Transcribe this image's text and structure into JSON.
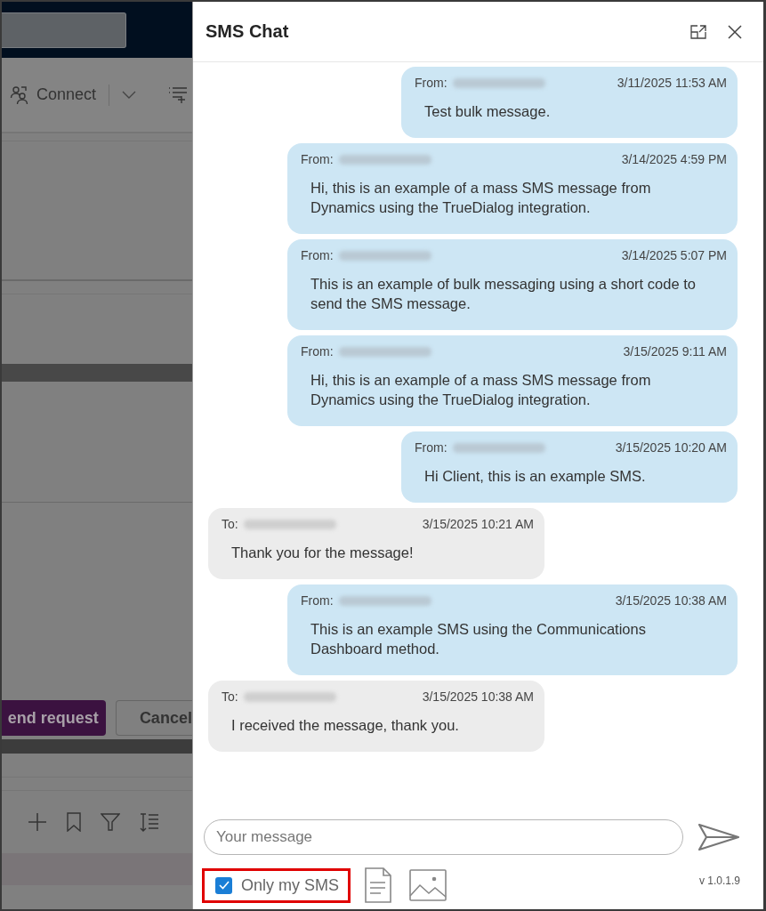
{
  "background": {
    "connect_label": "Connect",
    "primary_button": "end request",
    "secondary_button": "Cancel"
  },
  "panel": {
    "title": "SMS Chat"
  },
  "messages": [
    {
      "kind": "outgoing",
      "label": "From:",
      "timestamp": "3/11/2025 11:53 AM",
      "text": "Test bulk message."
    },
    {
      "kind": "outgoing",
      "label": "From:",
      "timestamp": "3/14/2025 4:59 PM",
      "text": "Hi, this is an example of a mass SMS message from Dynamics using the TrueDialog integration."
    },
    {
      "kind": "outgoing",
      "label": "From:",
      "timestamp": "3/14/2025 5:07 PM",
      "text": "This is an example of bulk messaging using a short code to send the SMS message."
    },
    {
      "kind": "outgoing",
      "label": "From:",
      "timestamp": "3/15/2025 9:11 AM",
      "text": "Hi, this is an example of a mass SMS message from Dynamics using the TrueDialog integration."
    },
    {
      "kind": "outgoing",
      "label": "From:",
      "timestamp": "3/15/2025 10:20 AM",
      "text": "Hi Client, this is an example SMS."
    },
    {
      "kind": "incoming",
      "label": "To:",
      "timestamp": "3/15/2025 10:21 AM",
      "text": "Thank you for the message!"
    },
    {
      "kind": "outgoing",
      "label": "From:",
      "timestamp": "3/15/2025 10:38 AM",
      "text": "This is an example SMS using the Communications Dashboard method."
    },
    {
      "kind": "incoming",
      "label": "To:",
      "timestamp": "3/15/2025 10:38 AM",
      "text": "I received the message, thank you."
    }
  ],
  "composer": {
    "placeholder": "Your message"
  },
  "filter": {
    "label": "Only my SMS",
    "checked": true
  },
  "version": "v 1.0.1.9"
}
